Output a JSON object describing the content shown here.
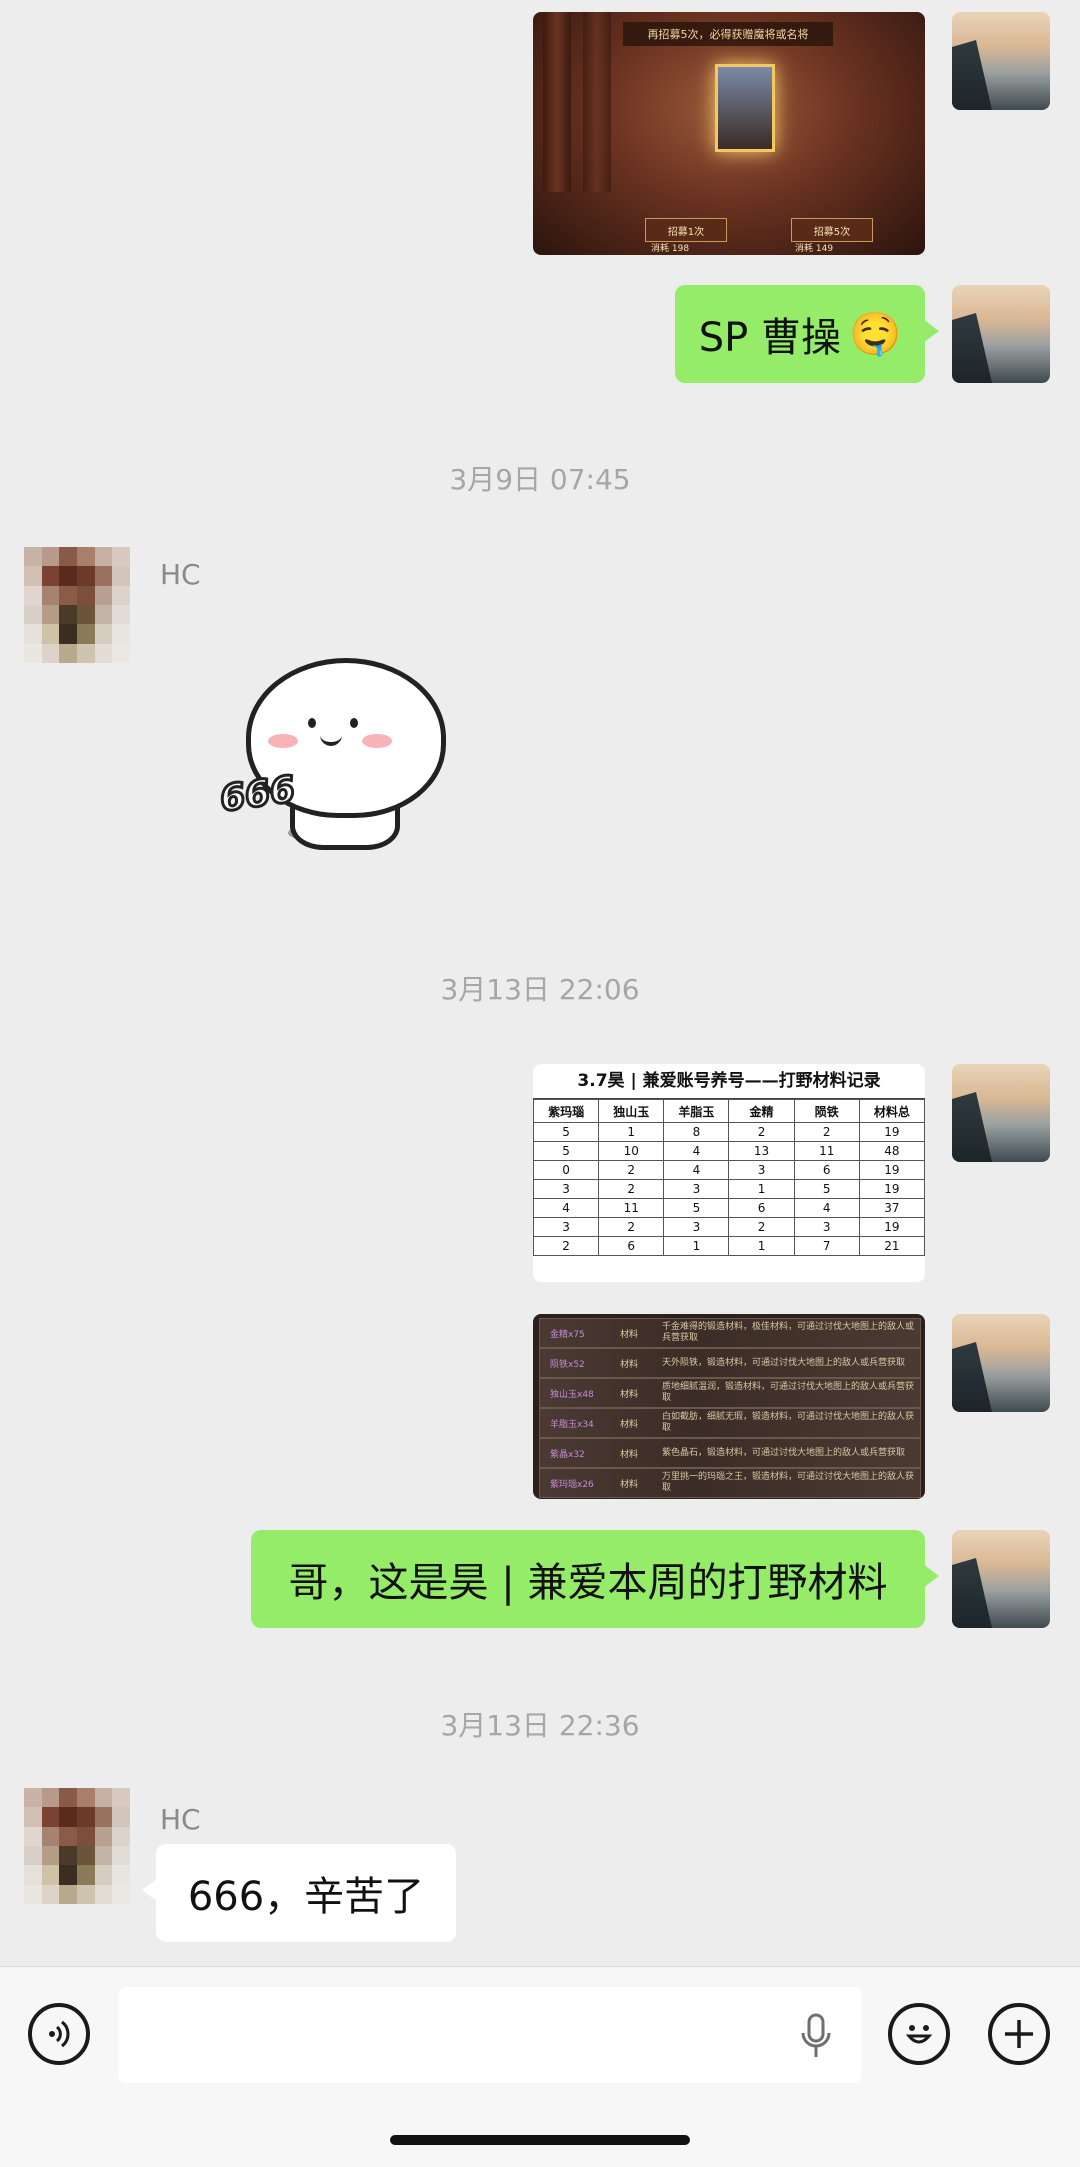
{
  "messages": {
    "m1": {
      "sender": "self",
      "type": "image",
      "alt": "",
      "game_top_text": "再招募5次，必得获赠魔将或名将",
      "game_btn1": "招募1次",
      "game_btn2": "招募5次",
      "game_cost1": "消耗 198",
      "game_cost2": "消耗 149"
    },
    "m2": {
      "sender": "self",
      "type": "text",
      "text": "SP 曹操",
      "emoji": "🤤"
    },
    "t1": {
      "type": "timestamp",
      "text": "3月9日 07:45"
    },
    "m3": {
      "sender": "HC",
      "type": "sticker",
      "sender_name": "HC",
      "sticker_text": "666"
    },
    "t2": {
      "type": "timestamp",
      "text": "3月13日 22:06"
    },
    "m4": {
      "sender": "self",
      "type": "image",
      "table": {
        "title": "3.7昊 | 兼爱账号养号——打野材料记录",
        "headers": [
          "紫玛瑙",
          "独山玉",
          "羊脂玉",
          "金精",
          "陨铁",
          "材料总"
        ],
        "rows": [
          [
            "5",
            "1",
            "8",
            "2",
            "2",
            "19"
          ],
          [
            "5",
            "10",
            "4",
            "13",
            "11",
            "48"
          ],
          [
            "0",
            "2",
            "4",
            "3",
            "6",
            "19"
          ],
          [
            "3",
            "2",
            "3",
            "1",
            "5",
            "19"
          ],
          [
            "4",
            "11",
            "5",
            "6",
            "4",
            "37"
          ],
          [
            "3",
            "2",
            "3",
            "2",
            "3",
            "19"
          ],
          [
            "2",
            "6",
            "1",
            "1",
            "7",
            "21"
          ]
        ]
      }
    },
    "m5": {
      "sender": "self",
      "type": "image",
      "materials": [
        {
          "name": "金精x75",
          "type": "材料",
          "desc": "千金难得的锻造材料，极佳材料，可通过讨伐大地图上的敌人或兵营获取"
        },
        {
          "name": "陨铁x52",
          "type": "材料",
          "desc": "天外陨铁，锻造材料，可通过讨伐大地图上的敌人或兵营获取"
        },
        {
          "name": "独山玉x48",
          "type": "材料",
          "desc": "质地细腻温润，锻造材料，可通过讨伐大地图上的敌人或兵营获取"
        },
        {
          "name": "羊脂玉x34",
          "type": "材料",
          "desc": "白如截肪，细腻无瑕，锻造材料，可通过讨伐大地图上的敌人获取"
        },
        {
          "name": "紫晶x32",
          "type": "材料",
          "desc": "紫色晶石，锻造材料，可通过讨伐大地图上的敌人或兵营获取"
        },
        {
          "name": "紫玛瑙x26",
          "type": "材料",
          "desc": "万里挑一的玛瑙之王，锻造材料，可通过讨伐大地图上的敌人获取"
        }
      ]
    },
    "m6": {
      "sender": "self",
      "type": "text",
      "text": "哥，这是昊 | 兼爱本周的打野材料"
    },
    "t3": {
      "type": "timestamp",
      "text": "3月13日 22:36"
    },
    "m7": {
      "sender": "HC",
      "type": "text",
      "sender_name": "HC",
      "text": "666，辛苦了"
    }
  },
  "input_bar": {
    "voice_icon": "voice-icon",
    "mic_icon": "microphone-icon",
    "emoji_icon": "smiley-icon",
    "plus_icon": "plus-icon",
    "placeholder": ""
  },
  "colors": {
    "background": "#ededed",
    "self_bubble": "#95ec69",
    "other_bubble": "#ffffff"
  }
}
